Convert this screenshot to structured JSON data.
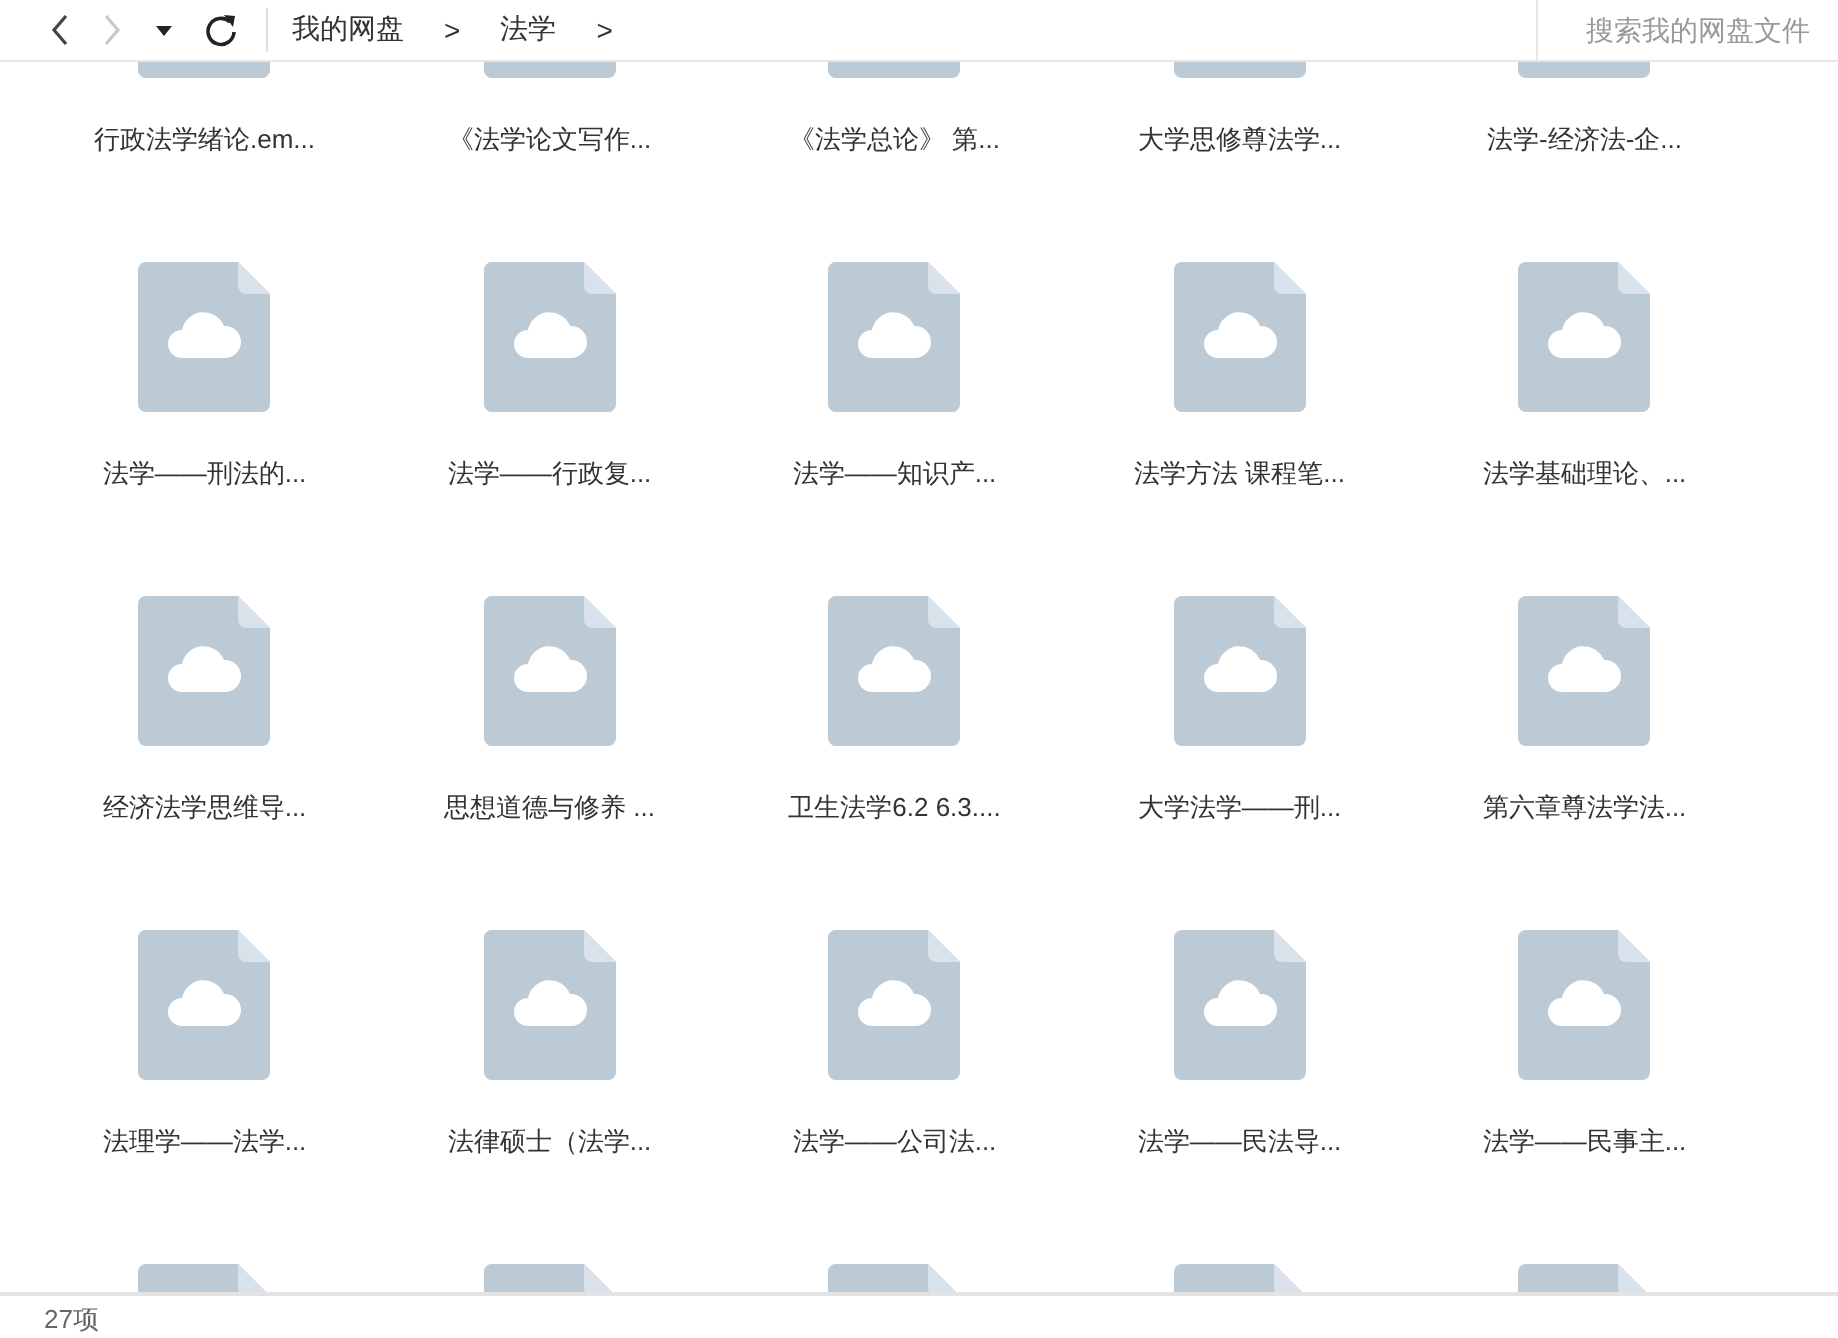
{
  "toolbar": {
    "back": {
      "disabled": false
    },
    "forward": {
      "disabled": true
    },
    "breadcrumb": [
      {
        "label": "我的网盘",
        "separator": ">"
      },
      {
        "label": "法学",
        "separator": ">"
      }
    ],
    "search": {
      "placeholder": "搜索我的网盘文件"
    }
  },
  "files": [
    {
      "kind": "cloud-file",
      "name": "行政法学绪论.em..."
    },
    {
      "kind": "cloud-file",
      "name": "《法学论文写作..."
    },
    {
      "kind": "cloud-file",
      "name": "《法学总论》 第..."
    },
    {
      "kind": "cloud-file",
      "name": "大学思修尊法学..."
    },
    {
      "kind": "cloud-file",
      "name": "法学-经济法-企..."
    },
    {
      "kind": "cloud-file",
      "name": "法学——刑法的..."
    },
    {
      "kind": "cloud-file",
      "name": "法学——行政复..."
    },
    {
      "kind": "cloud-file",
      "name": "法学——知识产..."
    },
    {
      "kind": "cloud-file",
      "name": "法学方法 课程笔..."
    },
    {
      "kind": "cloud-file",
      "name": "法学基础理论、..."
    },
    {
      "kind": "cloud-file",
      "name": "经济法学思维导..."
    },
    {
      "kind": "cloud-file",
      "name": "思想道德与修养 ..."
    },
    {
      "kind": "cloud-file",
      "name": "卫生法学6.2 6.3...."
    },
    {
      "kind": "cloud-file",
      "name": "大学法学——刑..."
    },
    {
      "kind": "cloud-file",
      "name": "第六章尊法学法..."
    },
    {
      "kind": "cloud-file",
      "name": "法理学——法学..."
    },
    {
      "kind": "cloud-file",
      "name": "法律硕士（法学..."
    },
    {
      "kind": "cloud-file",
      "name": "法学——公司法..."
    },
    {
      "kind": "cloud-file",
      "name": "法学——民法导..."
    },
    {
      "kind": "cloud-file",
      "name": "法学——民事主..."
    },
    {
      "kind": "cloud-file"
    },
    {
      "kind": "cloud-file"
    },
    {
      "kind": "cloud-file"
    },
    {
      "kind": "cloud-file"
    },
    {
      "kind": "cloud-file"
    }
  ],
  "status_bar": {
    "count": "27项"
  }
}
